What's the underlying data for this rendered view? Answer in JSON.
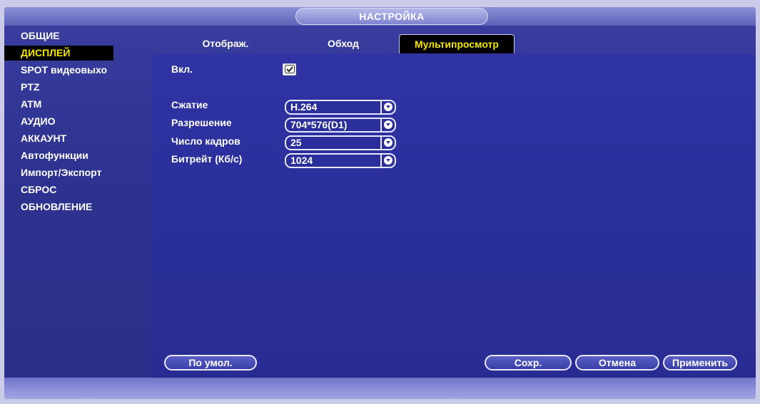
{
  "header": {
    "title": "НАСТРОЙКА"
  },
  "sidebar": {
    "items": [
      {
        "label": "ОБЩИЕ"
      },
      {
        "label": "ДИСПЛЕЙ"
      },
      {
        "label": "SPOT видеовыхо"
      },
      {
        "label": "PTZ"
      },
      {
        "label": "ATM"
      },
      {
        "label": "АУДИО"
      },
      {
        "label": "АККАУНТ"
      },
      {
        "label": "Автофункции"
      },
      {
        "label": "Импорт/Экспорт"
      },
      {
        "label": "СБРОС"
      },
      {
        "label": "ОБНОВЛЕНИЕ"
      }
    ],
    "active_index": 1
  },
  "tabs": [
    {
      "label": "Отображ."
    },
    {
      "label": "Обход"
    },
    {
      "label": "Мультипросмотр"
    }
  ],
  "form": {
    "enable": {
      "label": "Вкл.",
      "checked": true
    },
    "compression": {
      "label": "Сжатие",
      "value": "H.264"
    },
    "resolution": {
      "label": "Разрешение",
      "value": "704*576(D1)"
    },
    "framerate": {
      "label": "Число кадров",
      "value": "25"
    },
    "bitrate": {
      "label": "Битрейт (Кб/с)",
      "value": "1024"
    }
  },
  "buttons": {
    "default": "По умол.",
    "save": "Сохр.",
    "cancel": "Отмена",
    "apply": "Применить"
  },
  "colors": {
    "accent_text": "#f6e700",
    "panel_bg": "#2b2f9a",
    "active_bg": "#000000"
  }
}
